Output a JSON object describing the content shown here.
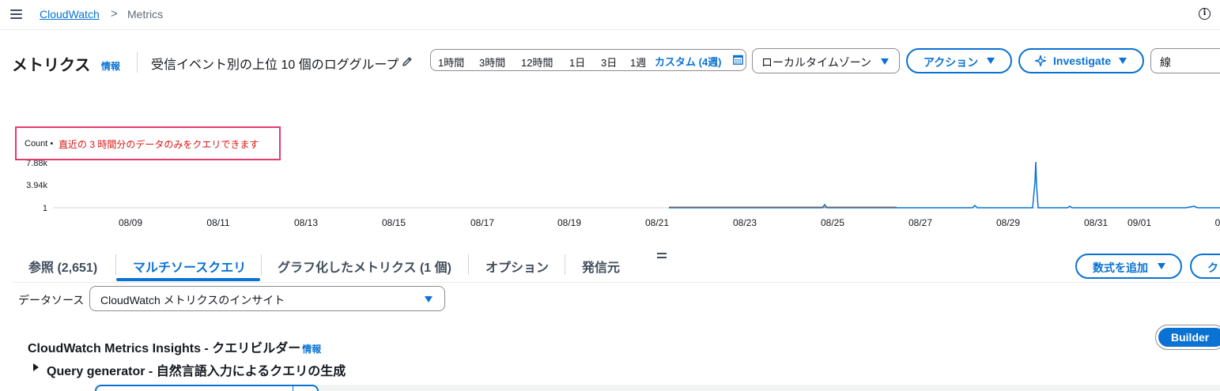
{
  "nav": {
    "breadcrumb_link": "CloudWatch",
    "breadcrumb_sep": ">",
    "breadcrumb_current": "Metrics",
    "info_glyph": "i"
  },
  "header": {
    "title": "メトリクス",
    "title_info": "情報",
    "graph_title": "受信イベント別の上位 10 個のロググループ"
  },
  "time_range": {
    "options": [
      "1時間",
      "3時間",
      "12時間",
      "1日",
      "3日",
      "1週"
    ],
    "active": "カスタム (4週)"
  },
  "timezone": {
    "value": "ローカルタイムゾーン"
  },
  "actions": {
    "label": "アクション"
  },
  "investigate": {
    "label": "Investigate"
  },
  "chart_type": {
    "value": "線"
  },
  "notice": {
    "metric": "Count •",
    "message": "直近の 3 時間分のデータのみをクエリできます"
  },
  "chart_data": {
    "type": "line",
    "y_ticks": [
      "7.88k",
      "3.94k",
      "1"
    ],
    "x_ticks": [
      "08/09",
      "08/11",
      "08/13",
      "08/15",
      "08/17",
      "08/19",
      "08/21",
      "08/23",
      "08/25",
      "08/27",
      "08/29",
      "08/31",
      "09/01",
      "0"
    ],
    "series": [
      {
        "color": "#ec7211"
      },
      {
        "color": "#0972d3"
      }
    ]
  },
  "tabs": [
    {
      "label": "参照 (2,651)"
    },
    {
      "label": "マルチソースクエリ"
    },
    {
      "label": "グラフ化したメトリクス (1 個)"
    },
    {
      "label": "オプション"
    },
    {
      "label": "発信元"
    }
  ],
  "add_math": {
    "label": "数式を追加"
  },
  "cut_button": {
    "label": "ク"
  },
  "datasource": {
    "label": "データソース",
    "value": "CloudWatch メトリクスのインサイト"
  },
  "builder": {
    "title": "CloudWatch Metrics Insights - クエリビルダー",
    "info": "情報",
    "query_generator": "Query generator - 自然言語入力によるクエリの生成",
    "mode": "Builder"
  }
}
